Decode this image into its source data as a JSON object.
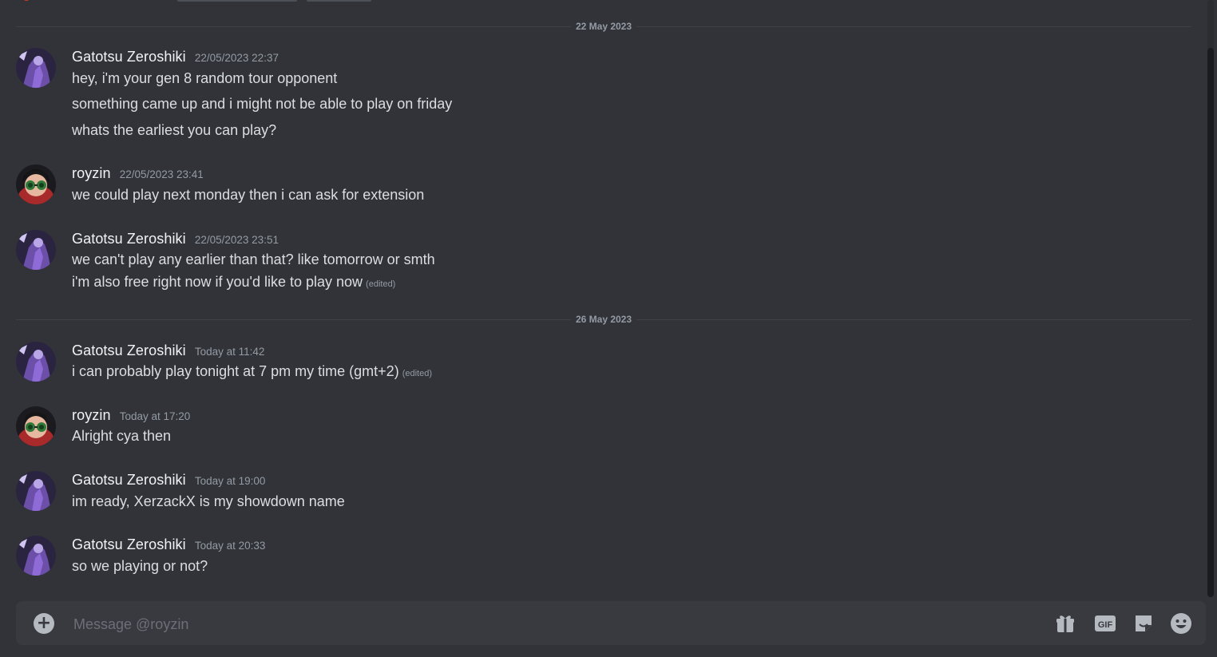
{
  "dividers": [
    "22 May 2023",
    "26 May 2023"
  ],
  "messages": [
    {
      "author": "Gatotsu Zeroshiki",
      "time": "22/05/2023 22:37",
      "lines": [
        "hey, i'm your gen 8 random tour opponent",
        "something came up and i might not be able to play on friday",
        "whats the earliest you can play?"
      ]
    },
    {
      "author": "royzin",
      "time": "22/05/2023 23:41",
      "lines": [
        "we could play next monday then i can ask for extension"
      ]
    },
    {
      "author": "Gatotsu Zeroshiki",
      "time": "22/05/2023 23:51",
      "lines": [
        "we can't play any earlier than that? like tomorrow or smth",
        "i'm also free right now if you'd like to play now"
      ],
      "edited": "(edited)"
    },
    {
      "author": "Gatotsu Zeroshiki",
      "time": "Today at 11:42",
      "lines": [
        "i can probably play tonight at 7 pm my time (gmt+2)"
      ],
      "edited": "(edited)"
    },
    {
      "author": "royzin",
      "time": "Today at 17:20",
      "lines": [
        "Alright cya then"
      ]
    },
    {
      "author": "Gatotsu Zeroshiki",
      "time": "Today at 19:00",
      "lines": [
        "im ready, XerzackX is my showdown name"
      ]
    },
    {
      "author": "Gatotsu Zeroshiki",
      "time": "Today at 20:33",
      "lines": [
        "so we playing or not?"
      ]
    }
  ],
  "composer": {
    "placeholder": "Message @royzin",
    "icons": [
      "plus-circle-icon",
      "gift-icon",
      "gif-icon",
      "sticker-icon",
      "emoji-icon"
    ],
    "gif_label": "GIF"
  },
  "colors": {
    "background": "#313338",
    "composer": "#383a40",
    "text": "#dbdee1",
    "muted": "#949ba4",
    "username": "#f2f3f5"
  }
}
